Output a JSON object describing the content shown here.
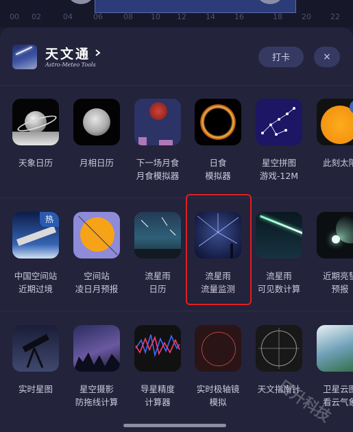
{
  "timeline": {
    "ticks": [
      "00",
      "02",
      "04",
      "06",
      "08",
      "10",
      "12",
      "14",
      "16",
      "18",
      "20",
      "22"
    ]
  },
  "header": {
    "title": "天文通",
    "subtitle": "Astro-Meteo Tools",
    "checkin_label": "打卡",
    "close_label": "×"
  },
  "tools": {
    "row1": [
      {
        "label": "天象日历",
        "icon": "saturn-icon"
      },
      {
        "label": "月相日历",
        "icon": "moon-icon"
      },
      {
        "label": "下一场月食\n月食模拟器",
        "icon": "lunar-eclipse-icon"
      },
      {
        "label": "日食\n模拟器",
        "icon": "solar-eclipse-icon"
      },
      {
        "label": "星空拼图\n游戏-12M",
        "icon": "constellation-icon"
      },
      {
        "label": "此刻太阳",
        "icon": "sun-icon",
        "badge": "新"
      }
    ],
    "row2": [
      {
        "label": "中国空间站\n近期过境",
        "icon": "space-station-icon",
        "badge": "热"
      },
      {
        "label": "空间站\n凌日月预报",
        "icon": "transit-icon"
      },
      {
        "label": "流星雨\n日历",
        "icon": "meteor-calendar-icon"
      },
      {
        "label": "流星雨\n流量监测",
        "icon": "meteor-monitor-icon"
      },
      {
        "label": "流星雨\n可见数计算",
        "icon": "meteor-count-icon"
      },
      {
        "label": "近期亮彗\n预报",
        "icon": "comet-icon"
      }
    ],
    "row3": [
      {
        "label": "实时星图",
        "icon": "telescope-icon"
      },
      {
        "label": "星空摄影\n防拖线计算",
        "icon": "milky-way-icon"
      },
      {
        "label": "导星精度\n计算器",
        "icon": "guiding-graph-icon"
      },
      {
        "label": "实时极轴镜\n模拟",
        "icon": "polar-scope-icon"
      },
      {
        "label": "天文指南针",
        "icon": "compass-icon"
      },
      {
        "label": "卫星云图\n看云气象",
        "icon": "weather-satellite-icon"
      }
    ]
  },
  "watermark": "日升科技"
}
